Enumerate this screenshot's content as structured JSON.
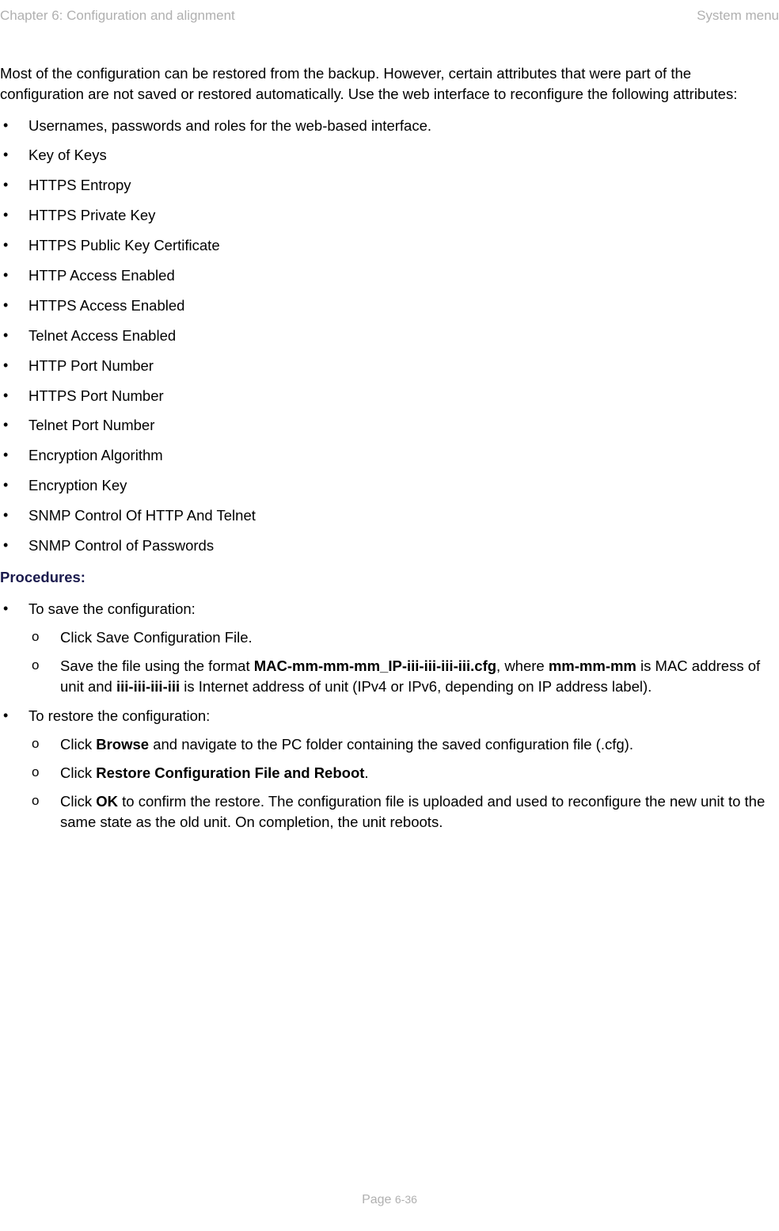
{
  "header": {
    "left": "Chapter 6:  Configuration and alignment",
    "right": "System menu"
  },
  "intro": "Most of the configuration can be restored from the backup. However, certain attributes that were part of the configuration are not saved or restored automatically. Use the web interface to reconfigure the following attributes:",
  "attributes": [
    "Usernames, passwords and roles for the web-based interface.",
    "Key of Keys",
    "HTTPS Entropy",
    "HTTPS Private Key",
    "HTTPS Public Key Certificate",
    "HTTP Access Enabled",
    "HTTPS Access Enabled",
    "Telnet Access Enabled",
    "HTTP Port Number",
    "HTTPS Port Number",
    "Telnet Port Number",
    "Encryption Algorithm",
    "Encryption Key",
    "SNMP Control Of HTTP And Telnet",
    "SNMP Control of Passwords"
  ],
  "procedures_heading": "Procedures:",
  "proc_save": {
    "title": "To save the configuration:",
    "step1": "Click Save Configuration File.",
    "step2": {
      "prefix": "Save the file using the format ",
      "bold1": "MAC-mm-mm-mm_IP-iii-iii-iii-iii.cfg",
      "mid1": ", where ",
      "bold2": "mm-mm-mm",
      "mid2": " is MAC address of unit and ",
      "bold3": "iii-iii-iii-iii",
      "suffix": " is Internet address of unit (IPv4 or IPv6, depending on IP address label)."
    }
  },
  "proc_restore": {
    "title": "To restore the configuration:",
    "step1": {
      "prefix": "Click ",
      "bold": "Browse",
      "suffix": " and navigate to the PC folder containing the saved configuration file (.cfg)."
    },
    "step2": {
      "prefix": "Click ",
      "bold": "Restore Configuration File and Reboot",
      "suffix": "."
    },
    "step3": {
      "prefix": "Click ",
      "bold": "OK",
      "suffix": " to confirm the restore. The configuration file is uploaded and used to reconfigure the new unit to the same state as the old unit. On completion, the unit reboots."
    }
  },
  "footer": {
    "page_label": "Page ",
    "page_num": "6-36"
  }
}
